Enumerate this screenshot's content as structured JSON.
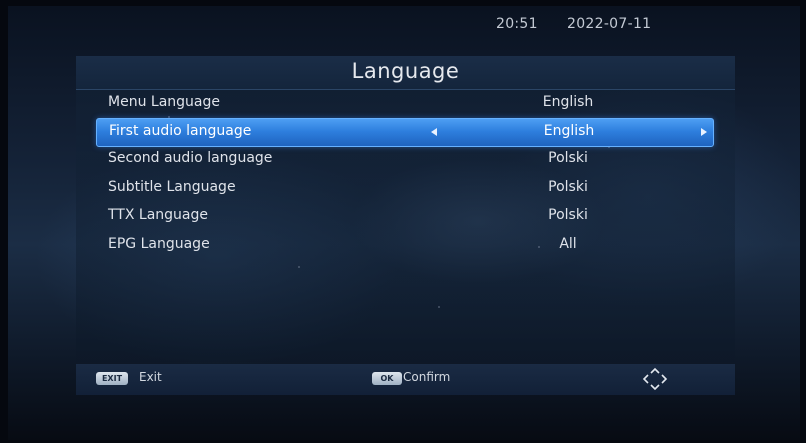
{
  "status": {
    "time": "20:51",
    "date": "2022-07-11"
  },
  "page": {
    "title": "Language"
  },
  "menu": {
    "items": [
      {
        "label": "Menu Language",
        "value": "English"
      },
      {
        "label": "First audio language",
        "value": "English"
      },
      {
        "label": "Second audio language",
        "value": "Polski"
      },
      {
        "label": "Subtitle Language",
        "value": "Polski"
      },
      {
        "label": "TTX Language",
        "value": "Polski"
      },
      {
        "label": "EPG Language",
        "value": "All"
      }
    ],
    "selected_index": 1
  },
  "footer": {
    "exit_key": "EXIT",
    "exit_label": "Exit",
    "ok_key": "OK",
    "ok_label": "Confirm",
    "nav_icon": "navigation-arrows-icon"
  },
  "colors": {
    "selection": "#2e7fde",
    "text": "#dfe3ea"
  }
}
